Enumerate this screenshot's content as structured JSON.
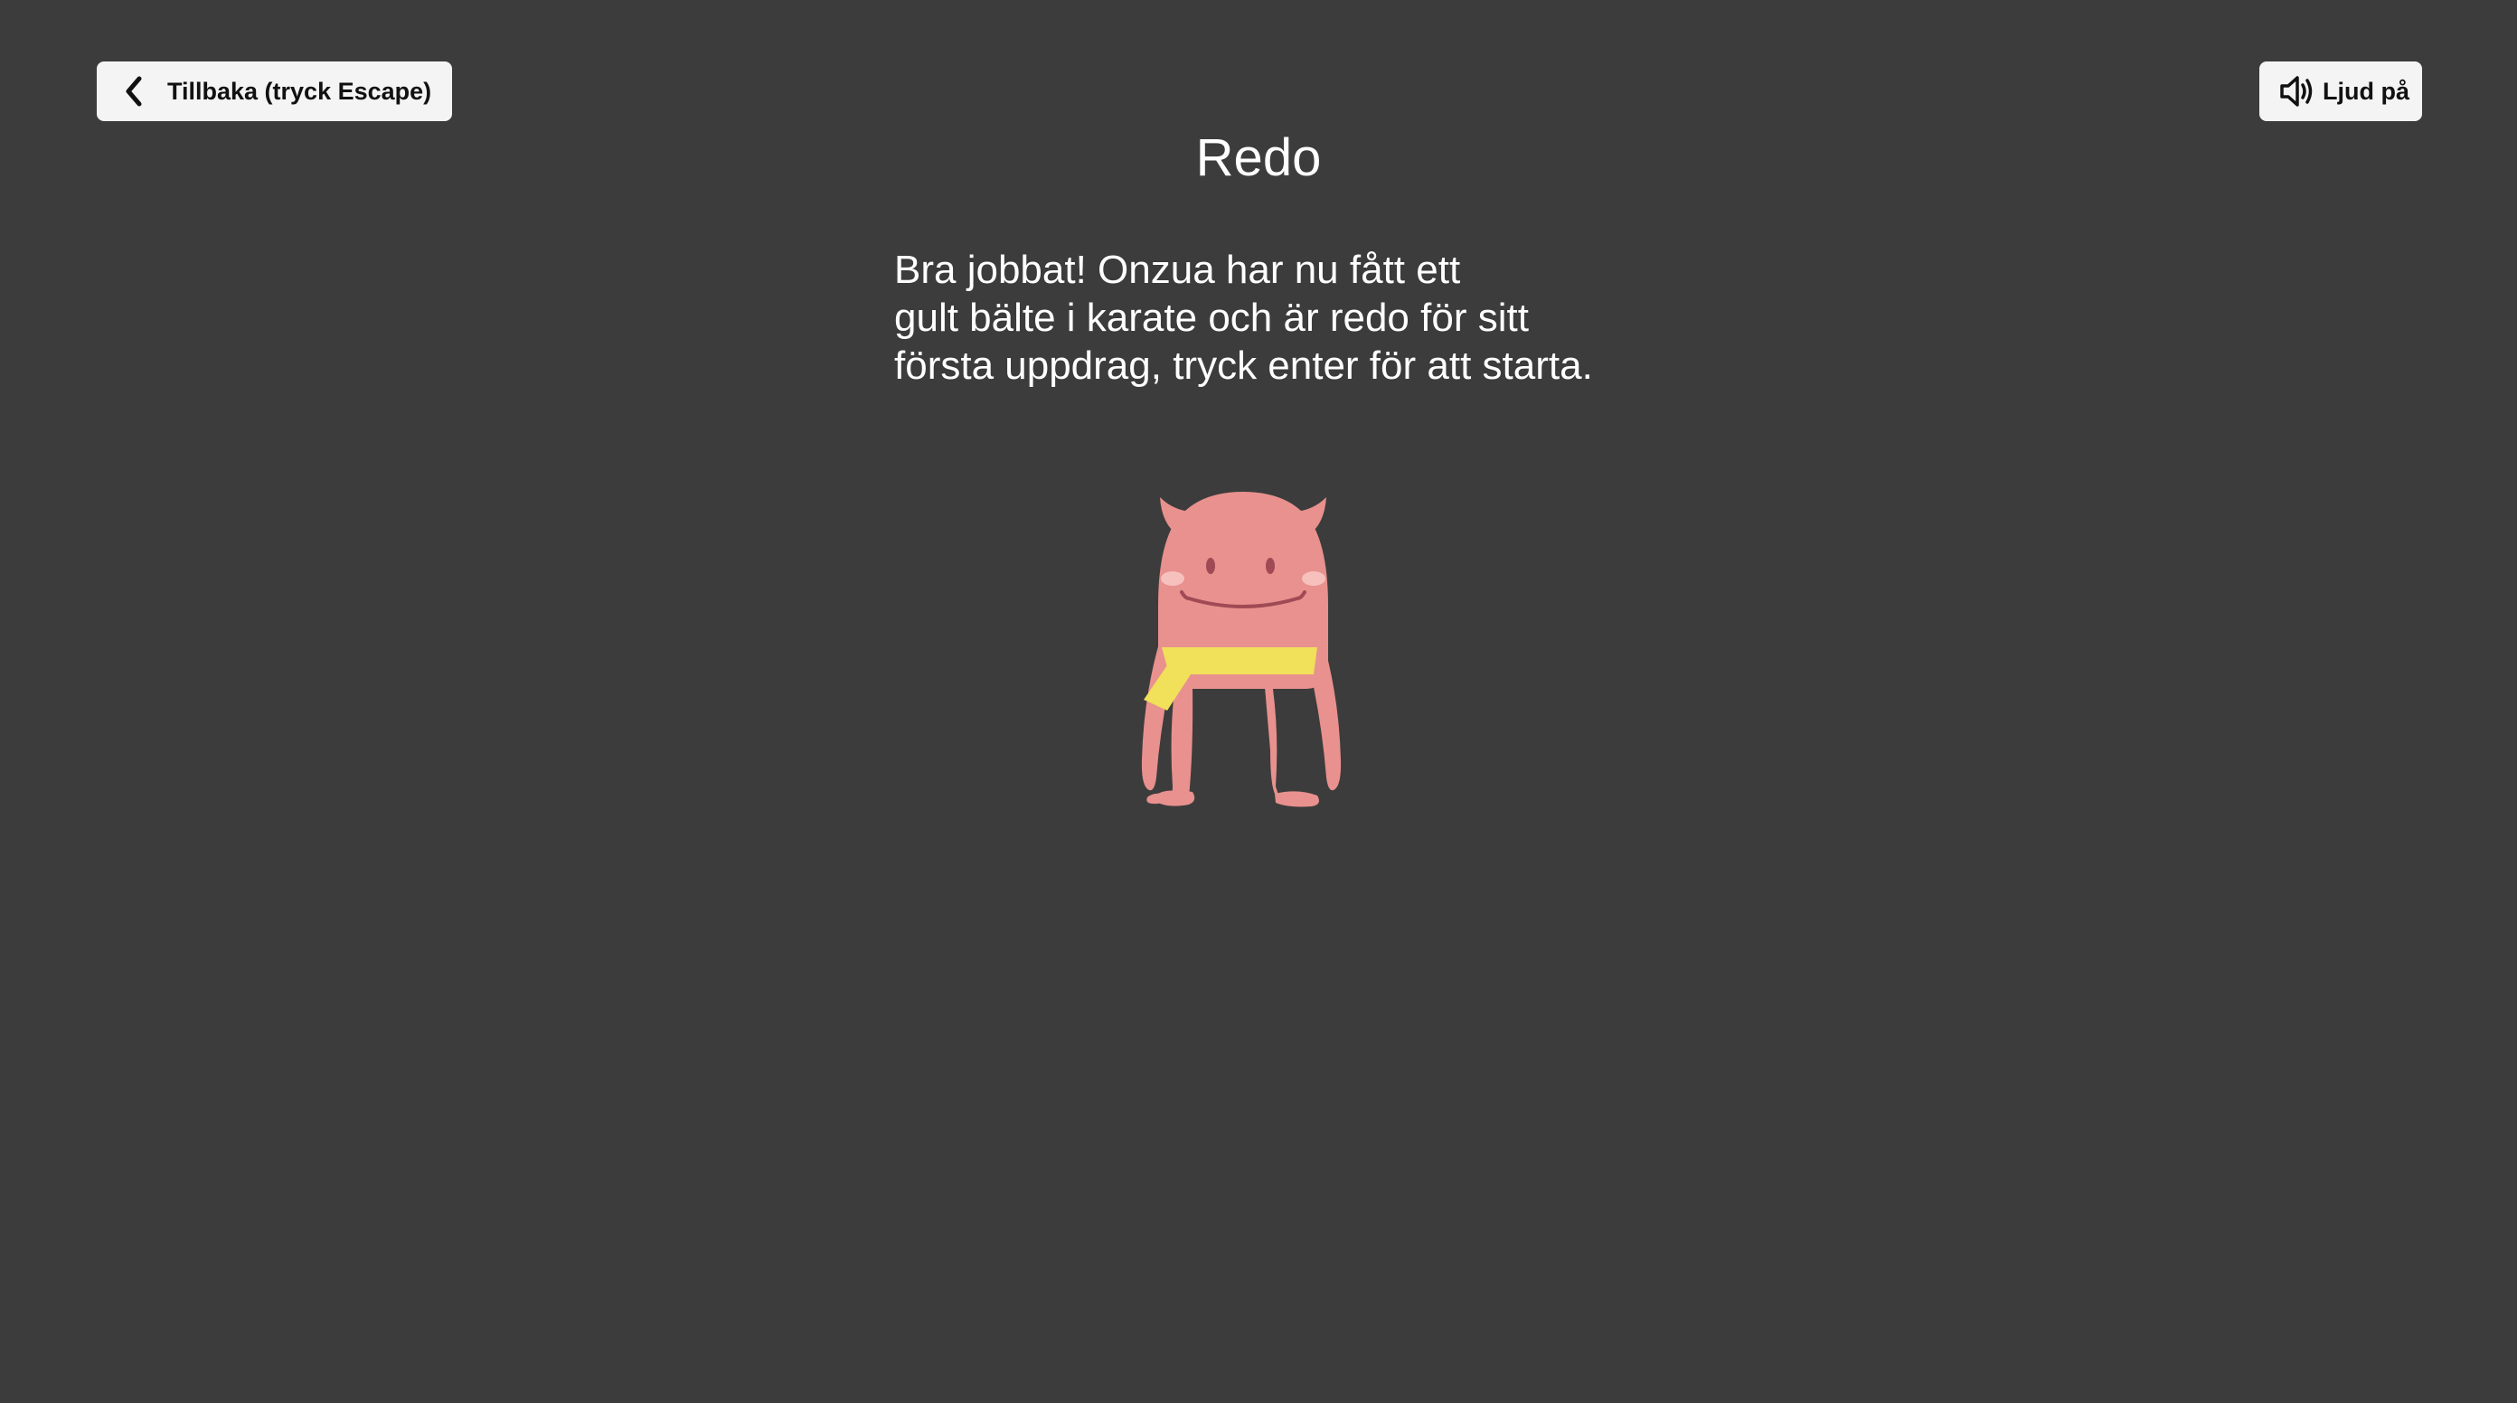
{
  "back_button": {
    "label": "Tillbaka (tryck Escape)",
    "icon": "chevron-left-icon"
  },
  "sound_button": {
    "label": "Ljud på",
    "icon": "speaker-icon"
  },
  "title": "Redo",
  "message": {
    "lines": [
      "Bra jobbat! Onzua har nu fått ett",
      "gult bälte i karate och är redo för sitt",
      "första uppdrag, tryck enter för att starta."
    ]
  },
  "character": {
    "name": "Onzua",
    "belt_color": "#f0e05a",
    "body_color": "#e8918e"
  },
  "colors": {
    "background": "#3c3c3c",
    "button_bg": "#f4f4f4",
    "text": "#ffffff"
  }
}
